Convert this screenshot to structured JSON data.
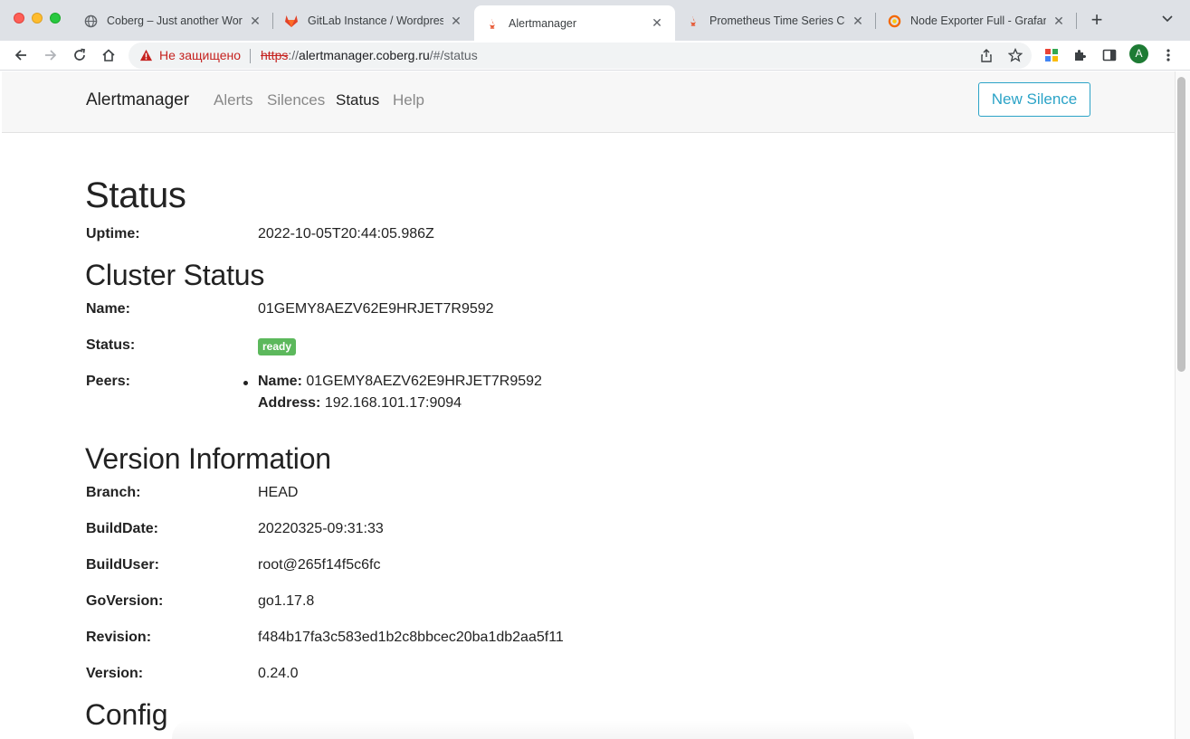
{
  "browser": {
    "tabs": [
      {
        "title": "Coberg – Just another Word",
        "icon": "globe-icon"
      },
      {
        "title": "GitLab Instance / Wordpress",
        "icon": "gitlab-icon"
      },
      {
        "title": "Alertmanager",
        "icon": "prometheus-icon"
      },
      {
        "title": "Prometheus Time Series Co",
        "icon": "prometheus-icon"
      },
      {
        "title": "Node Exporter Full - Grafan",
        "icon": "grafana-icon"
      }
    ],
    "active_tab": 2,
    "security_text": "Не защищено",
    "url_scheme": "https",
    "url_sep": "://",
    "url_host": "alertmanager.coberg.ru",
    "url_path": "/#/status",
    "profile_initial": "A"
  },
  "nav": {
    "brand": "Alertmanager",
    "links": [
      "Alerts",
      "Silences",
      "Status",
      "Help"
    ],
    "active_link": "Status",
    "new_silence": "New Silence"
  },
  "status": {
    "heading": "Status",
    "uptime_label": "Uptime:",
    "uptime_value": "2022-10-05T20:44:05.986Z"
  },
  "cluster": {
    "heading": "Cluster Status",
    "name_label": "Name:",
    "name_value": "01GEMY8AEZV62E9HRJET7R9592",
    "status_label": "Status:",
    "status_badge": "ready",
    "peers_label": "Peers:",
    "peer_name_label": "Name:",
    "peer_name_value": "01GEMY8AEZV62E9HRJET7R9592",
    "peer_address_label": "Address:",
    "peer_address_value": "192.168.101.17:9094"
  },
  "version": {
    "heading": "Version Information",
    "rows": [
      {
        "label": "Branch:",
        "value": "HEAD"
      },
      {
        "label": "BuildDate:",
        "value": "20220325-09:31:33"
      },
      {
        "label": "BuildUser:",
        "value": "root@265f14f5c6fc"
      },
      {
        "label": "GoVersion:",
        "value": "go1.17.8"
      },
      {
        "label": "Revision:",
        "value": "f484b17fa3c583ed1b2c8bbcec20ba1db2aa5f11"
      },
      {
        "label": "Version:",
        "value": "0.24.0"
      }
    ]
  },
  "config": {
    "heading": "Config"
  }
}
